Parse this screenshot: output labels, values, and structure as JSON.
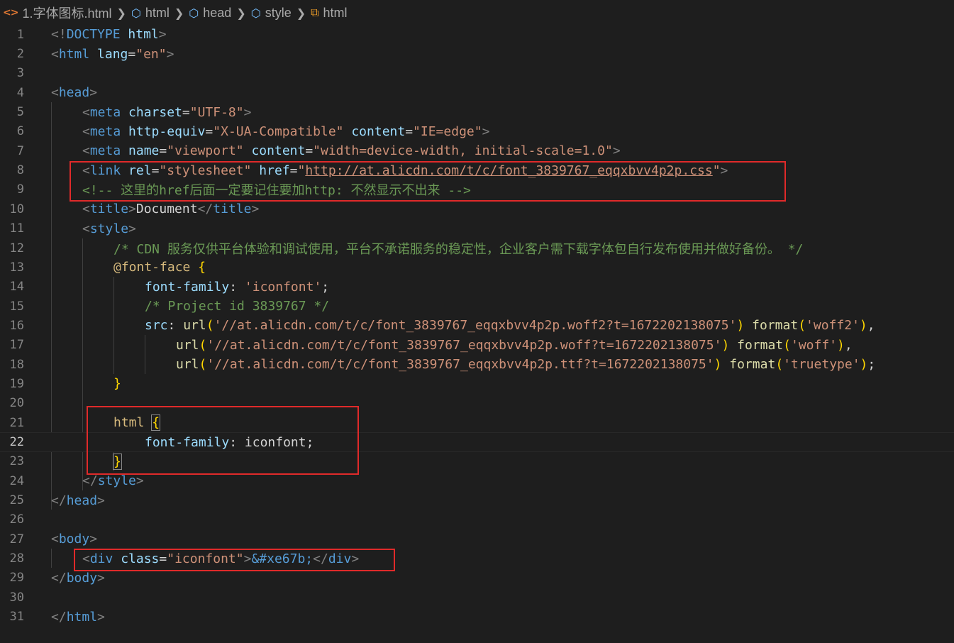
{
  "breadcrumb": {
    "file": "1.字体图标.html",
    "items": [
      "html",
      "head",
      "style",
      "html"
    ]
  },
  "editor": {
    "current_line": 22,
    "line_numbers": [
      "1",
      "2",
      "3",
      "4",
      "5",
      "6",
      "7",
      "8",
      "9",
      "10",
      "11",
      "12",
      "13",
      "14",
      "15",
      "16",
      "17",
      "18",
      "19",
      "20",
      "21",
      "22",
      "23",
      "24",
      "25",
      "26",
      "27",
      "28",
      "29",
      "30",
      "31"
    ],
    "lines": {
      "l1": {
        "p1": "<!",
        "doctype": "DOCTYPE",
        "sp": " ",
        "html": "html",
        "p2": ">"
      },
      "l2": {
        "p1": "<",
        "tag": "html",
        "sp": " ",
        "attr": "lang",
        "eq": "=",
        "val": "\"en\"",
        "p2": ">"
      },
      "l4": {
        "p1": "<",
        "tag": "head",
        "p2": ">"
      },
      "l5": {
        "p1": "<",
        "tag": "meta",
        "sp": " ",
        "attr": "charset",
        "eq": "=",
        "val": "\"UTF-8\"",
        "p2": ">"
      },
      "l6": {
        "p1": "<",
        "tag": "meta",
        "sp": " ",
        "attr1": "http-equiv",
        "eq1": "=",
        "val1": "\"X-UA-Compatible\"",
        "sp2": " ",
        "attr2": "content",
        "eq2": "=",
        "val2": "\"IE=edge\"",
        "p2": ">"
      },
      "l7": {
        "p1": "<",
        "tag": "meta",
        "sp": " ",
        "attr1": "name",
        "eq1": "=",
        "val1": "\"viewport\"",
        "sp2": " ",
        "attr2": "content",
        "eq2": "=",
        "val2": "\"width=device-width, initial-scale=1.0\"",
        "p2": ">"
      },
      "l8": {
        "p1": "<",
        "tag": "link",
        "sp": " ",
        "attr1": "rel",
        "eq1": "=",
        "val1": "\"stylesheet\"",
        "sp2": " ",
        "attr2": "href",
        "eq2": "=",
        "q1": "\"",
        "url": "http://at.alicdn.com/t/c/font_3839767_eqqxbvv4p2p.css",
        "q2": "\"",
        "p2": ">"
      },
      "l9": {
        "comment": "<!-- 这里的href后面一定要记住要加http: 不然显示不出来 -->"
      },
      "l10": {
        "p1": "<",
        "tag1": "title",
        "p2": ">",
        "text": "Document",
        "p3": "</",
        "tag2": "title",
        "p4": ">"
      },
      "l11": {
        "p1": "<",
        "tag": "style",
        "p2": ">"
      },
      "l12": {
        "comment": "/* CDN 服务仅供平台体验和调试使用，平台不承诺服务的稳定性，企业客户需下载字体包自行发布使用并做好备份。 */"
      },
      "l13": {
        "sel": "@font-face",
        "sp": " ",
        "brace": "{"
      },
      "l14": {
        "prop": "font-family",
        "colon": ": ",
        "val": "'iconfont'",
        "semi": ";"
      },
      "l15": {
        "comment": "/* Project id 3839767 */"
      },
      "l16": {
        "prop": "src",
        "colon": ": ",
        "fn1": "url",
        "po1": "(",
        "str1": "'//at.alicdn.com/t/c/font_3839767_eqqxbvv4p2p.woff2?t=1672202138075'",
        "pc1": ")",
        "sp": " ",
        "fn2": "format",
        "po2": "(",
        "str2": "'woff2'",
        "pc2": ")",
        "comma": ","
      },
      "l17": {
        "fn1": "url",
        "po1": "(",
        "str1": "'//at.alicdn.com/t/c/font_3839767_eqqxbvv4p2p.woff?t=1672202138075'",
        "pc1": ")",
        "sp": " ",
        "fn2": "format",
        "po2": "(",
        "str2": "'woff'",
        "pc2": ")",
        "comma": ","
      },
      "l18": {
        "fn1": "url",
        "po1": "(",
        "str1": "'//at.alicdn.com/t/c/font_3839767_eqqxbvv4p2p.ttf?t=1672202138075'",
        "pc1": ")",
        "sp": " ",
        "fn2": "format",
        "po2": "(",
        "str2": "'truetype'",
        "pc2": ")",
        "semi": ";"
      },
      "l19": {
        "brace": "}"
      },
      "l21": {
        "sel": "html",
        "sp": " ",
        "brace": "{"
      },
      "l22": {
        "prop": "font-family",
        "colon": ": ",
        "val": "iconfont",
        "semi": ";"
      },
      "l23": {
        "brace": "}"
      },
      "l24": {
        "p1": "</",
        "tag": "style",
        "p2": ">"
      },
      "l25": {
        "p1": "</",
        "tag": "head",
        "p2": ">"
      },
      "l27": {
        "p1": "<",
        "tag": "body",
        "p2": ">"
      },
      "l28": {
        "p1": "<",
        "tag1": "div",
        "sp": " ",
        "attr": "class",
        "eq": "=",
        "val": "\"iconfont\"",
        "p2": ">",
        "entity": "&#xe67b;",
        "p3": "</",
        "tag2": "div",
        "p4": ">"
      },
      "l29": {
        "p1": "</",
        "tag": "body",
        "p2": ">"
      },
      "l31": {
        "p1": "</",
        "tag": "html",
        "p2": ">"
      }
    }
  },
  "colors": {
    "background": "#1e1e1e",
    "highlight_box": "#e02a2a",
    "tag": "#569cd6",
    "attribute": "#9cdcfe",
    "string": "#ce9178",
    "comment": "#6a9955",
    "selector": "#d7ba7d",
    "function": "#dcdcaa"
  },
  "icons": {
    "file": "html-file-icon",
    "element": "cube-icon",
    "style_rule": "css-rule-icon",
    "separator": "chevron-right-icon"
  }
}
